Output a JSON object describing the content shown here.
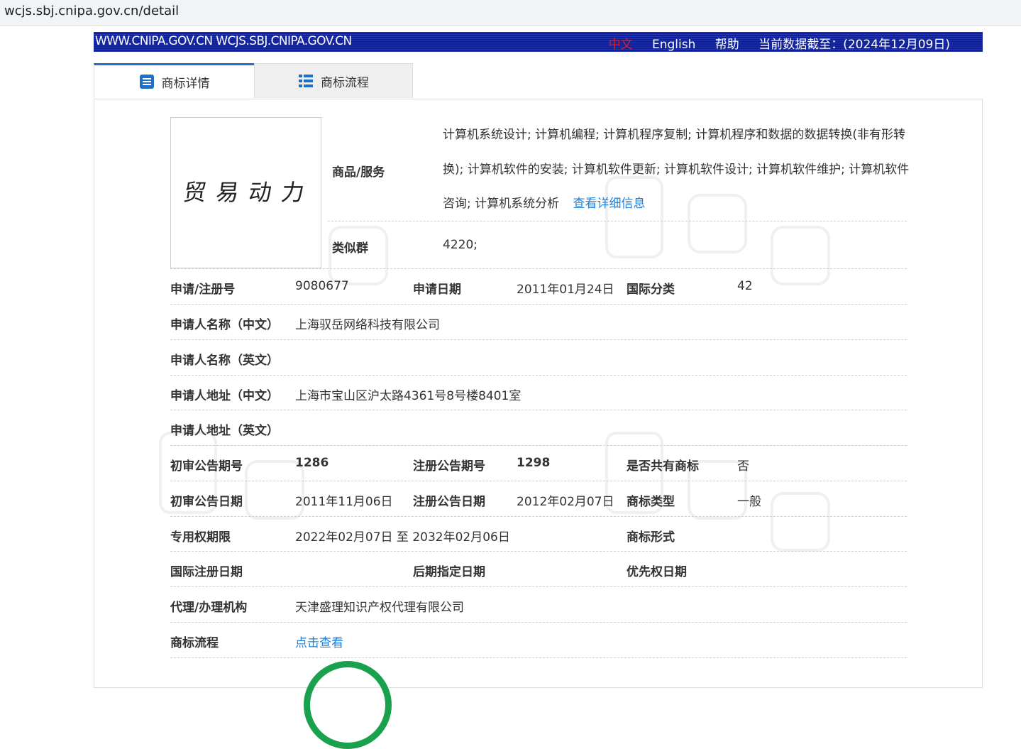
{
  "browser": {
    "url": "wcjs.sbj.cnipa.gov.cn/detail"
  },
  "header": {
    "site": "WWW.CNIPA.GOV.CN WCJS.SBJ.CNIPA.GOV.CN",
    "lang_cn": "中文",
    "lang_en": "English",
    "help": "帮助",
    "data_cutoff": "当前数据截至：(2024年12月09日)"
  },
  "tabs": [
    {
      "label": "商标详情",
      "icon": "document-list-icon",
      "active": true
    },
    {
      "label": "商标流程",
      "icon": "list-icon",
      "active": false
    }
  ],
  "trademark": {
    "image_text": "贸易动力",
    "goods_label": "商品/服务",
    "goods_value": "计算机系统设计; 计算机编程; 计算机程序复制; 计算机程序和数据的数据转换(非有形转换); 计算机软件的安装; 计算机软件更新; 计算机软件设计; 计算机软件维护; 计算机软件咨询; 计算机系统分析",
    "goods_more_link": "查看详细信息",
    "similar_label": "类似群",
    "similar_value": "4220;"
  },
  "fields": {
    "reg_no_label": "申请/注册号",
    "reg_no": "9080677",
    "app_date_label": "申请日期",
    "app_date": "2011年01月24日",
    "intl_class_label": "国际分类",
    "intl_class": "42",
    "applicant_cn_label": "申请人名称（中文）",
    "applicant_cn": "上海驭岳网络科技有限公司",
    "applicant_en_label": "申请人名称（英文）",
    "applicant_en": "",
    "address_cn_label": "申请人地址（中文）",
    "address_cn": "上海市宝山区沪太路4361号8号楼8401室",
    "address_en_label": "申请人地址（英文）",
    "address_en": "",
    "prelim_no_label": "初审公告期号",
    "prelim_no": "1286",
    "reg_pub_no_label": "注册公告期号",
    "reg_pub_no": "1298",
    "shared_label": "是否共有商标",
    "shared": "否",
    "prelim_date_label": "初审公告日期",
    "prelim_date": "2011年11月06日",
    "reg_pub_date_label": "注册公告日期",
    "reg_pub_date": "2012年02月07日",
    "type_label": "商标类型",
    "type": "一般",
    "term_label": "专用权期限",
    "term": "2022年02月07日 至 2032年02月06日",
    "form_label": "商标形式",
    "form": "",
    "intl_reg_label": "国际注册日期",
    "intl_reg": "",
    "later_label": "后期指定日期",
    "later": "",
    "priority_label": "优先权日期",
    "priority": "",
    "agent_label": "代理/办理机构",
    "agent": "天津盛理知识产权代理有限公司",
    "flow_label": "商标流程",
    "flow_link": "点击查看"
  },
  "colors": {
    "header_bg": "#0d1f9c",
    "tab_accent": "#1f6fc5",
    "link": "#1f7fd6",
    "active_lang": "#e02020"
  }
}
